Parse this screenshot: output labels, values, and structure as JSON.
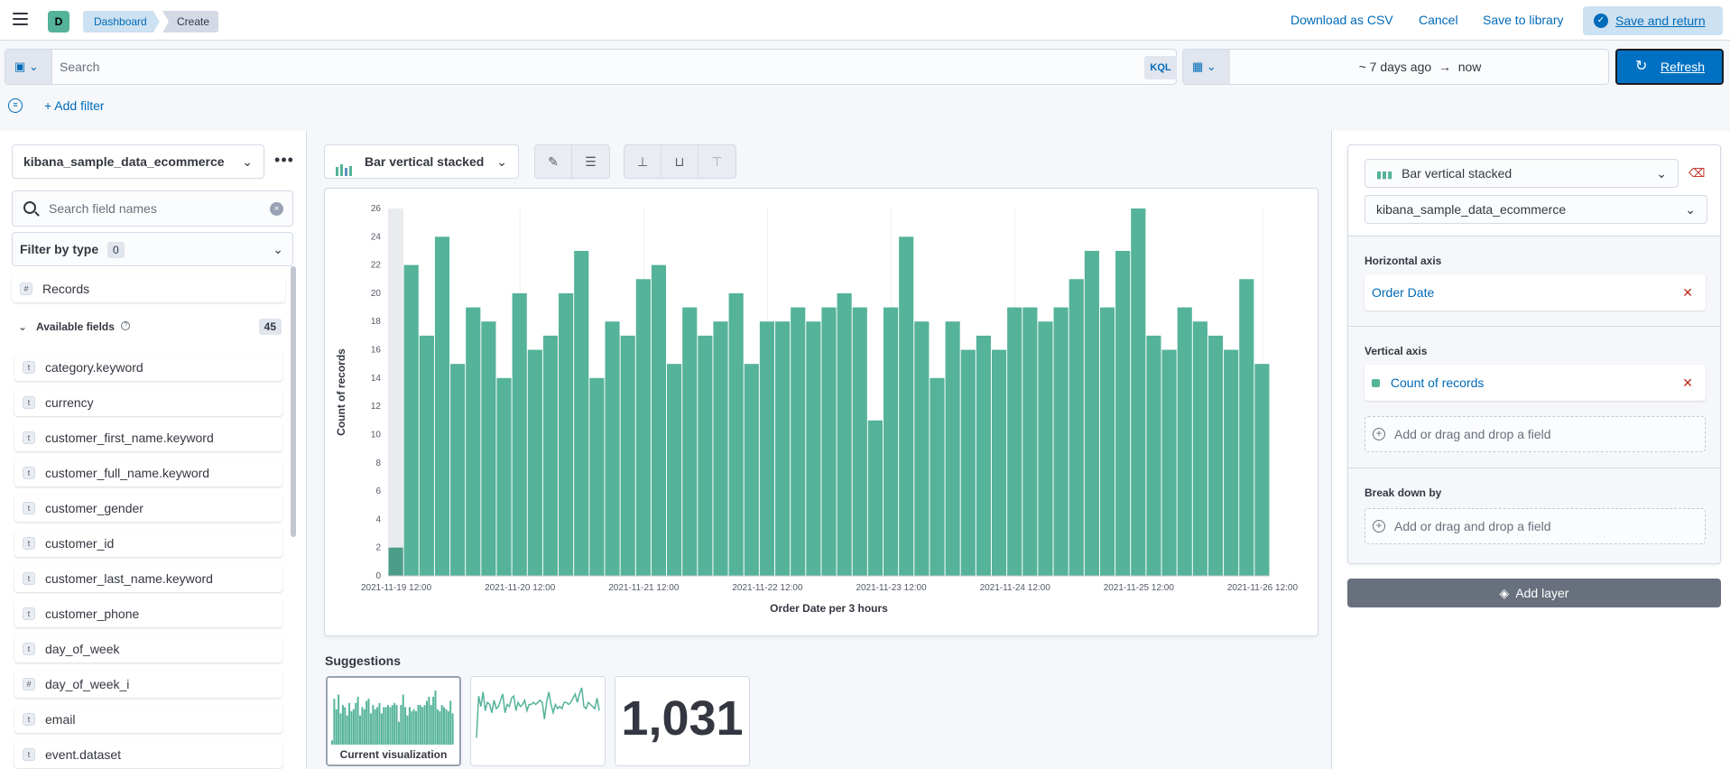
{
  "header": {
    "space_initial": "D",
    "breadcrumbs": [
      "Dashboard",
      "Create"
    ],
    "download_csv": "Download as CSV",
    "cancel": "Cancel",
    "save_library": "Save to library",
    "save_return": "Save and return"
  },
  "query": {
    "placeholder": "Search",
    "language": "KQL",
    "date_from": "~ 7 days ago",
    "arrow": "→",
    "date_to": "now",
    "refresh": "Refresh",
    "add_filter": "+ Add filter"
  },
  "sidebar": {
    "index_pattern": "kibana_sample_data_ecommerce",
    "search_placeholder": "Search field names",
    "filter_by_type": "Filter by type",
    "filter_count": "0",
    "records": "Records",
    "available_label": "Available fields",
    "available_count": "45",
    "fields": [
      {
        "type": "t",
        "name": "category.keyword"
      },
      {
        "type": "t",
        "name": "currency"
      },
      {
        "type": "t",
        "name": "customer_first_name.keyword"
      },
      {
        "type": "t",
        "name": "customer_full_name.keyword"
      },
      {
        "type": "t",
        "name": "customer_gender"
      },
      {
        "type": "t",
        "name": "customer_id"
      },
      {
        "type": "t",
        "name": "customer_last_name.keyword"
      },
      {
        "type": "t",
        "name": "customer_phone"
      },
      {
        "type": "t",
        "name": "day_of_week"
      },
      {
        "type": "#",
        "name": "day_of_week_i"
      },
      {
        "type": "t",
        "name": "email"
      },
      {
        "type": "t",
        "name": "event.dataset"
      }
    ]
  },
  "workspace": {
    "vis_type": "Bar vertical stacked",
    "suggestions_title": "Suggestions",
    "suggestion_current": "Current visualization",
    "suggestion_metric": "1,031"
  },
  "config": {
    "chart_type": "Bar vertical stacked",
    "index_pattern": "kibana_sample_data_ecommerce",
    "horizontal_axis": "Horizontal axis",
    "horizontal_field": "Order Date",
    "vertical_axis": "Vertical axis",
    "vertical_field": "Count of records",
    "drop_placeholder": "Add or drag and drop a field",
    "break_down": "Break down by",
    "add_layer": "Add layer"
  },
  "colors": {
    "bar": "#54b399",
    "accent": "#006bb8",
    "danger": "#bd271e"
  },
  "chart_data": {
    "type": "bar",
    "xlabel": "Order Date per 3 hours",
    "ylabel": "Count of records",
    "ylim": [
      0,
      26
    ],
    "yticks": [
      0,
      2,
      4,
      6,
      8,
      10,
      12,
      14,
      16,
      18,
      20,
      22,
      24,
      26
    ],
    "xtick_labels": [
      "2021-11-19 12:00",
      "2021-11-20 12:00",
      "2021-11-21 12:00",
      "2021-11-22 12:00",
      "2021-11-23 12:00",
      "2021-11-24 12:00",
      "2021-11-25 12:00",
      "2021-11-26 12:00"
    ],
    "series": [
      {
        "name": "Count of records",
        "values": [
          2,
          22,
          17,
          24,
          15,
          19,
          18,
          14,
          20,
          16,
          17,
          20,
          23,
          14,
          18,
          17,
          21,
          22,
          15,
          19,
          17,
          18,
          20,
          15,
          18,
          18,
          19,
          18,
          19,
          20,
          19,
          11,
          19,
          24,
          18,
          14,
          18,
          16,
          17,
          16,
          19,
          19,
          18,
          19,
          21,
          23,
          19,
          23,
          26,
          17,
          16,
          19,
          18,
          17,
          16,
          21,
          15
        ]
      }
    ]
  }
}
